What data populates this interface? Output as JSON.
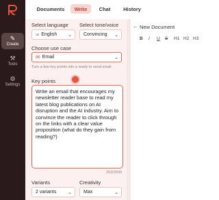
{
  "rail": {
    "items": [
      {
        "label": "Create",
        "icon": "✎"
      },
      {
        "label": "Tools",
        "icon": "⚒"
      },
      {
        "label": "Settings",
        "icon": "⚙"
      }
    ]
  },
  "tabs": [
    {
      "label": "Documents"
    },
    {
      "label": "Write"
    },
    {
      "label": "Chat"
    },
    {
      "label": "History"
    }
  ],
  "form": {
    "language_label": "Select language",
    "language_flag": "us",
    "language_value": "English",
    "tone_label": "Select tone/voice",
    "tone_value": "Convincing",
    "usecase_label": "Choose use case",
    "usecase_value": "Email",
    "usecase_hint": "Turn a few key points into a ready to send email",
    "keypoints_label": "Key points",
    "keypoints_value": "Write an email that encourages my newsletter reader base to read my latest blog publications on AI disruption and the AI industry. Aim to convince the reader to click through  on the links with a clear value proposition (what do they gain from reading?)",
    "counter": "253/2500",
    "variants_label": "Variants",
    "variants_value": "2 variants",
    "creativity_label": "Creativity",
    "creativity_value": "Max"
  },
  "editor": {
    "title": "New Document",
    "toolbar": [
      "B",
      "I",
      "U",
      "S",
      "H1",
      "H2",
      "H3"
    ]
  },
  "colors": {
    "accent": "#e8543f",
    "rail": "#2b1a1a",
    "panel": "#fdf1ef"
  }
}
